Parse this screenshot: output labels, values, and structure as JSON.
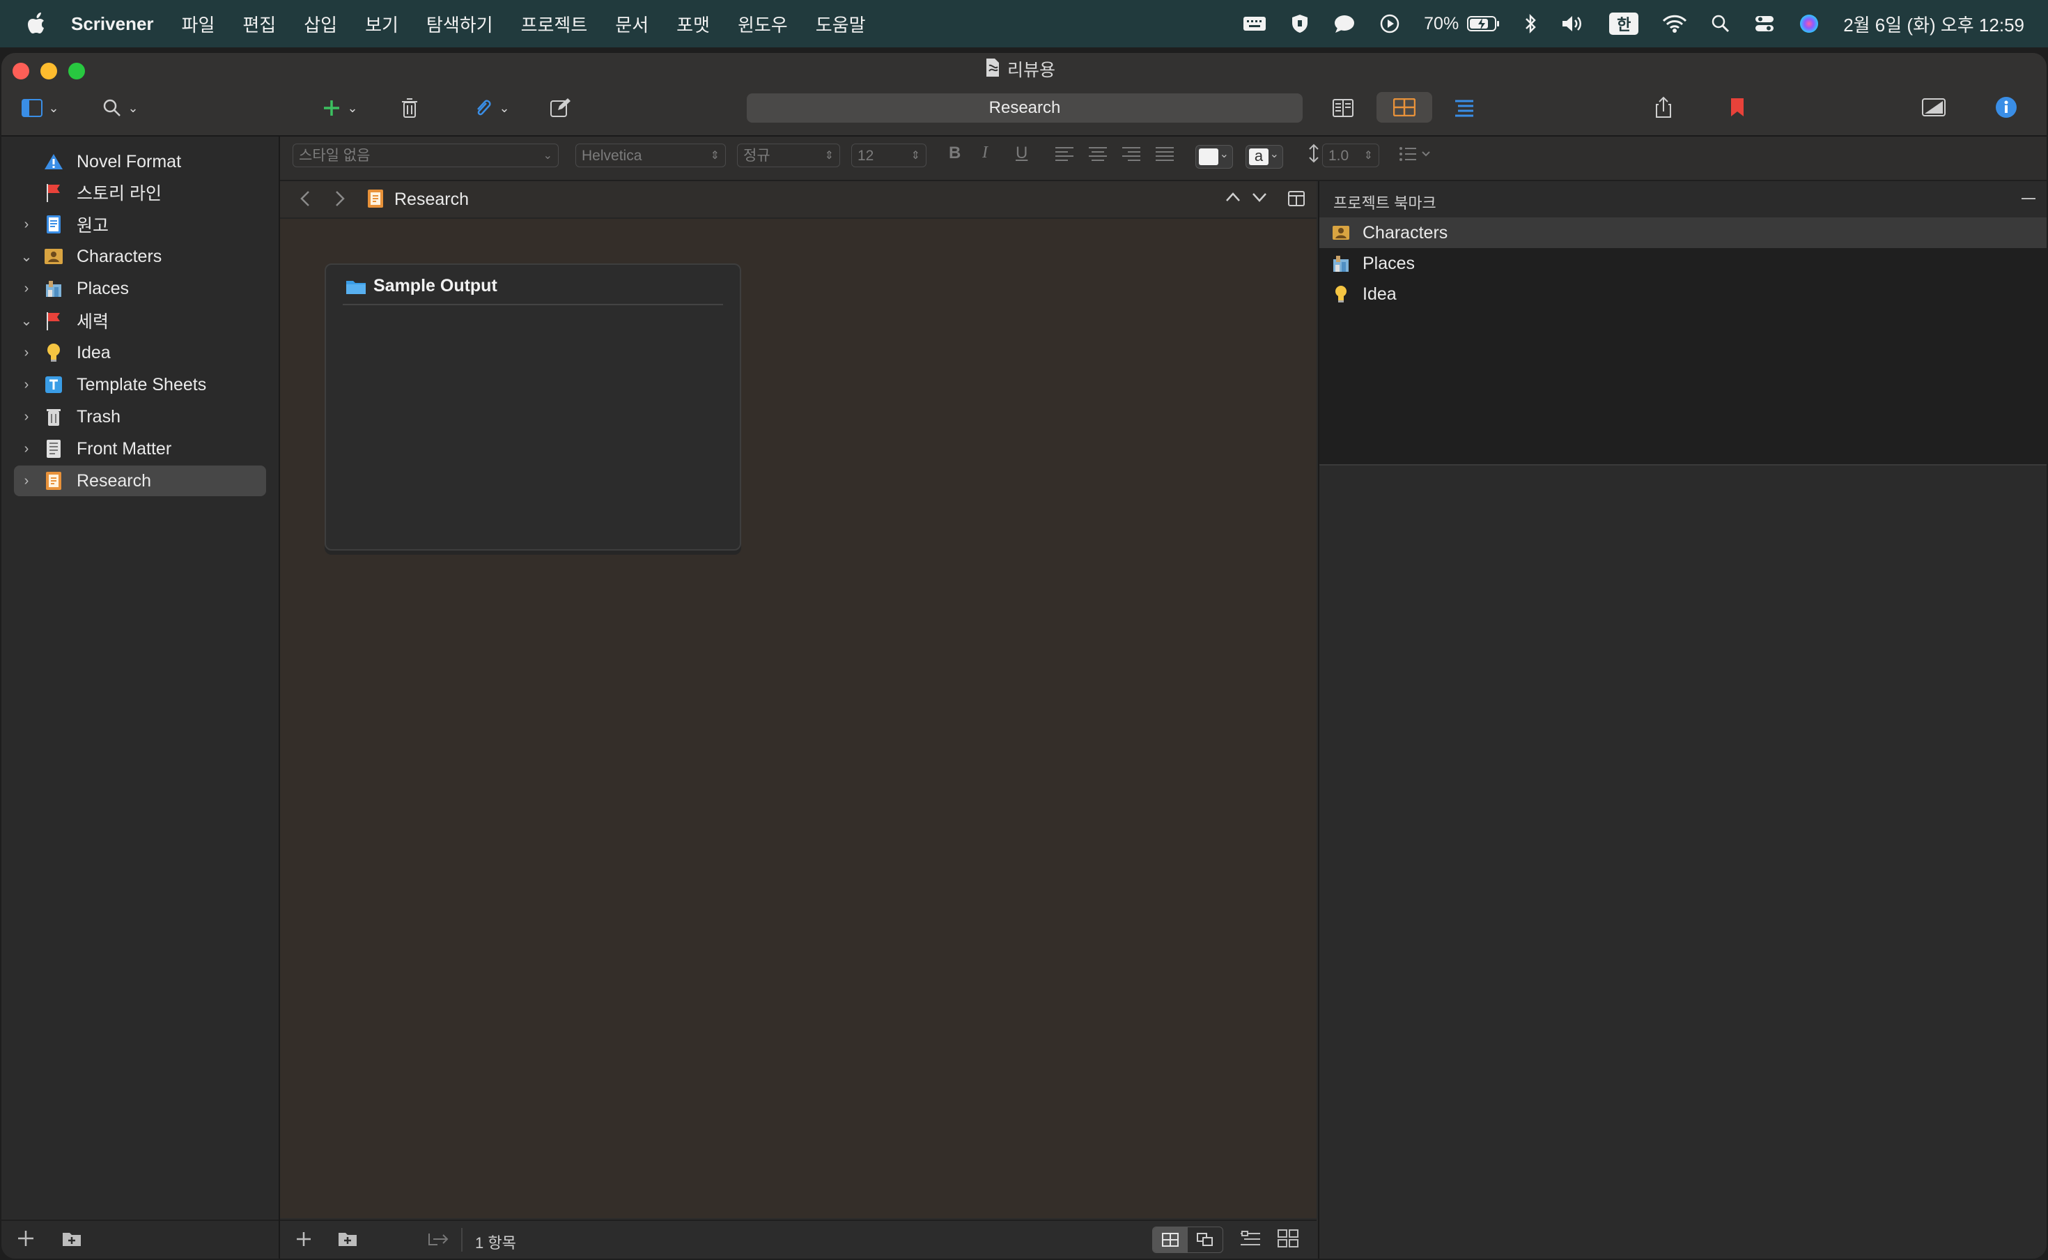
{
  "menubar": {
    "app": "Scrivener",
    "items": [
      "파일",
      "편집",
      "삽입",
      "보기",
      "탐색하기",
      "프로젝트",
      "문서",
      "포맷",
      "윈도우",
      "도움말"
    ],
    "battery": "70%",
    "input_method": "한",
    "datetime": "2월 6일 (화) 오후 12:59"
  },
  "window": {
    "title": "리뷰용",
    "search_value": "Research"
  },
  "binder": {
    "items": [
      {
        "label": "Novel Format",
        "icon": "warning-icon"
      },
      {
        "label": "스토리 라인",
        "icon": "flag-icon"
      },
      {
        "label": "원고",
        "icon": "manuscript-icon"
      },
      {
        "label": "Characters",
        "icon": "characters-icon"
      },
      {
        "label": "Places",
        "icon": "places-icon"
      },
      {
        "label": "세력",
        "icon": "flag-icon"
      },
      {
        "label": "Idea",
        "icon": "lightbulb-icon"
      },
      {
        "label": "Template Sheets",
        "icon": "template-icon"
      },
      {
        "label": "Trash",
        "icon": "trash-icon"
      },
      {
        "label": "Front Matter",
        "icon": "front-matter-icon"
      },
      {
        "label": "Research",
        "icon": "research-icon"
      }
    ]
  },
  "format_bar": {
    "style": "스타일 없음",
    "font": "Helvetica",
    "typeface": "정규",
    "size": "12",
    "bold": "B",
    "italic": "I",
    "underline": "U",
    "highlight": "a",
    "line_spacing": "1.0"
  },
  "editor": {
    "path_label": "Research",
    "card_title": "Sample Output",
    "item_count": "1 항목"
  },
  "inspector": {
    "header": "프로젝트 북마크",
    "bookmarks": [
      {
        "label": "Characters",
        "icon": "characters-icon"
      },
      {
        "label": "Places",
        "icon": "places-icon"
      },
      {
        "label": "Idea",
        "icon": "lightbulb-icon"
      }
    ]
  },
  "colors": {
    "accent_blue": "#3a8ee6",
    "bookmark_red": "#e8423a",
    "add_green": "#3cc060"
  }
}
